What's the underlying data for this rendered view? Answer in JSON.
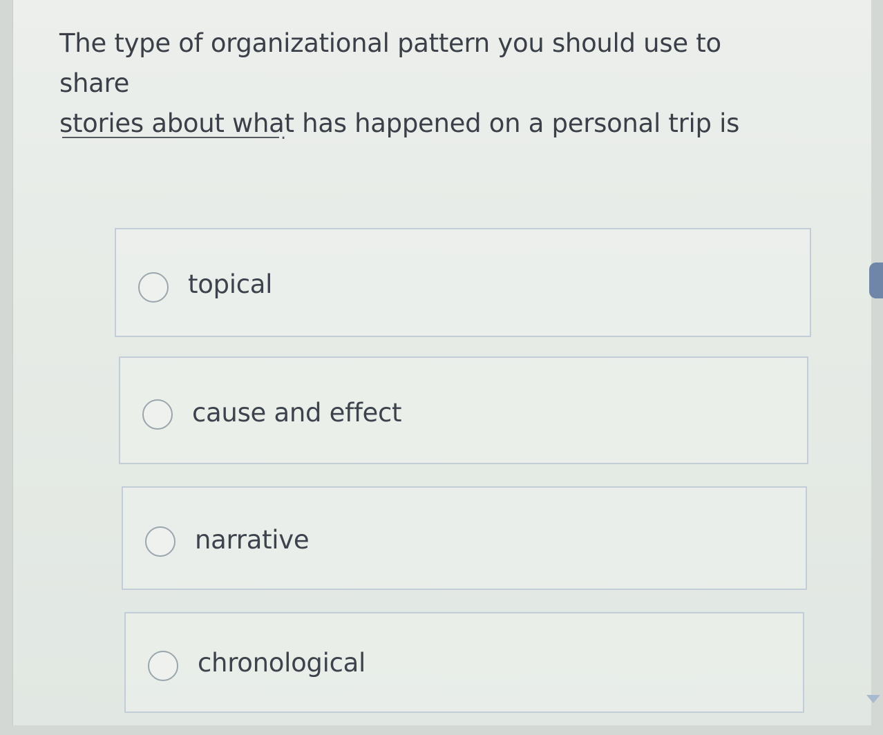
{
  "question": {
    "line1": "The type of organizational pattern you should use to share",
    "line2": "stories about what has happened on a personal trip is",
    "end_punctuation": "."
  },
  "options": [
    {
      "label": "topical",
      "selected": false
    },
    {
      "label": "cause and effect",
      "selected": false
    },
    {
      "label": "narrative",
      "selected": false
    },
    {
      "label": "chronological",
      "selected": false
    }
  ],
  "icons": {
    "radio": "radio-circle-icon",
    "scroll_down": "triangle-down-icon"
  },
  "colors": {
    "background": "#e6ebe6",
    "text": "#3a3f48",
    "option_border": "#c3cdd8",
    "scroll_thumb": "#6f86a8"
  }
}
